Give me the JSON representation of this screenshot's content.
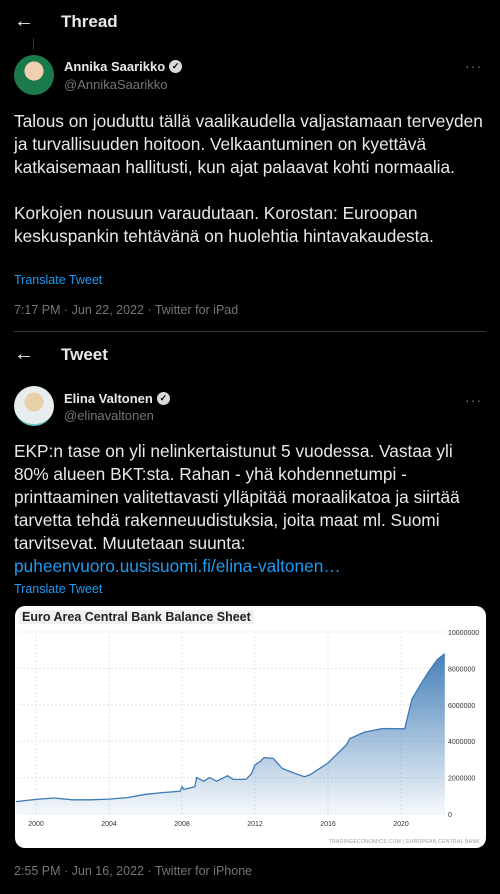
{
  "thread": {
    "back_icon": "arrow-left-icon",
    "title": "Thread"
  },
  "tweet1": {
    "name": "Annika Saarikko",
    "handle": "@AnnikaSaarikko",
    "verified": true,
    "text_p1": "Talous on jouduttu tällä vaalikaudella valjastamaan terveyden ja turvallisuuden hoitoon. Velkaantuminen on kyettävä katkaisemaan hallitusti, kun ajat palaavat kohti normaalia.",
    "text_p2": "Korkojen nousuun varaudutaan. Korostan: Euroopan keskuspankin tehtävänä on huolehtia hintavakaudesta.",
    "translate": "Translate Tweet",
    "meta": "7:17 PM · Jun 22, 2022 · Twitter for iPad"
  },
  "tweet_header": {
    "title": "Tweet"
  },
  "tweet2": {
    "name": "Elina Valtonen",
    "handle": "@elinavaltonen",
    "verified": true,
    "text": "EKP:n tase on yli nelinkertaistunut 5 vuodessa. Vastaa yli 80% alueen BKT:sta. Rahan - yhä kohdennetumpi - printtaaminen valitettavasti ylläpitää moraalikatoa ja siirtää tarvetta tehdä rakenneuudistuksia, joita maat ml. Suomi tarvitsevat. Muutetaan suunta: ",
    "link": "puheenvuoro.uusisuomi.fi/elina-valtonen…",
    "translate": "Translate Tweet",
    "meta": "2:55 PM · Jun 16, 2022 · Twitter for iPhone"
  },
  "chart_data": {
    "type": "area",
    "title": "Euro Area Central Bank Balance Sheet",
    "source": "TRADINGECONOMICS.COM | EUROPEAN CENTRAL BANK",
    "xlim": [
      1998.9,
      2022.6
    ],
    "ylim": [
      0,
      10000000
    ],
    "grid": true,
    "color": "#3d7ab5",
    "x_ticks": [
      "2000",
      "2004",
      "2008",
      "2012",
      "2016",
      "2020"
    ],
    "y_ticks": [
      "10000000",
      "8000000",
      "6000000",
      "4000000",
      "2000000",
      "0"
    ],
    "x": [
      1998.9,
      2000,
      2001,
      2002,
      2003,
      2004,
      2005,
      2006,
      2007,
      2007.9,
      2008,
      2008.1,
      2008.7,
      2008.8,
      2009.2,
      2009.5,
      2009.9,
      2010.5,
      2010.8,
      2011.5,
      2011.8,
      2012,
      2012.3,
      2012.5,
      2013,
      2013.5,
      2014,
      2014.7,
      2015,
      2016,
      2017,
      2017.2,
      2018,
      2019,
      2020.2,
      2020.4,
      2020.6,
      2021,
      2021.5,
      2022,
      2022.4
    ],
    "y": [
      680000,
      800000,
      880000,
      780000,
      780000,
      820000,
      900000,
      1080000,
      1180000,
      1250000,
      1500000,
      1350000,
      1500000,
      2000000,
      1800000,
      2000000,
      1800000,
      2100000,
      1900000,
      1900000,
      2200000,
      2700000,
      2900000,
      3100000,
      3050000,
      2500000,
      2300000,
      2050000,
      2150000,
      2800000,
      3800000,
      4150000,
      4500000,
      4700000,
      4680000,
      5500000,
      6300000,
      7000000,
      7800000,
      8500000,
      8800000
    ]
  }
}
